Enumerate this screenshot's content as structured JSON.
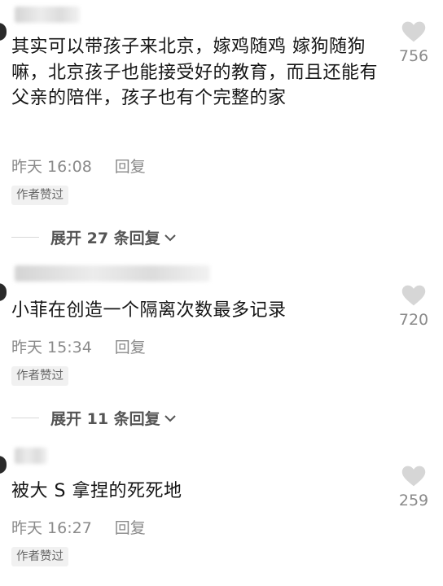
{
  "comments": [
    {
      "text": "其实可以带孩子来北京，嫁鸡随鸡 嫁狗随狗嘛，北京孩子也能接受好的教育，而且还能有父亲的陪伴，孩子也有个完整的家",
      "time": "昨天 16:08",
      "reply_label": "回复",
      "badge": "作者赞过",
      "likes": "756",
      "expand_label": "展开 27 条回复"
    },
    {
      "text": "小菲在创造一个隔离次数最多记录",
      "time": "昨天 15:34",
      "reply_label": "回复",
      "badge": "作者赞过",
      "likes": "720",
      "expand_label": "展开 11 条回复"
    },
    {
      "text": "被大 S 拿捏的死死地",
      "time": "昨天 16:27",
      "reply_label": "回复",
      "badge": "作者赞过",
      "likes": "259"
    }
  ],
  "colors": {
    "text": "#161616",
    "muted": "#8a8a8a",
    "badge_bg": "#f1f1f1",
    "heart": "#d6d6d6"
  },
  "icons": {
    "like": "heart-icon",
    "expand": "chevron-down-icon"
  }
}
